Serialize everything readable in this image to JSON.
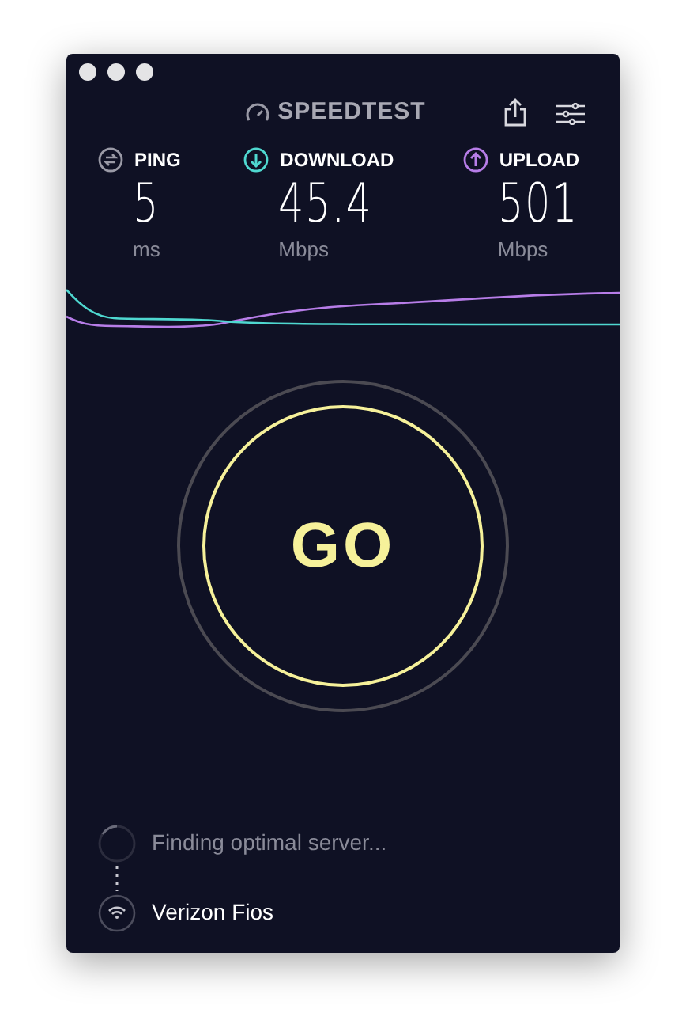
{
  "header": {
    "logo": "SPEEDTEST"
  },
  "metrics": [
    {
      "kind": "ping",
      "label": "PING",
      "value": "5",
      "unit": "ms",
      "color": "#9a9aa6"
    },
    {
      "kind": "download",
      "label": "DOWNLOAD",
      "value": "45.4",
      "unit": "Mbps",
      "color": "#4fd8d0"
    },
    {
      "kind": "upload",
      "label": "UPLOAD",
      "value": "501",
      "unit": "Mbps",
      "color": "#b77de8"
    }
  ],
  "go_button": {
    "label": "GO"
  },
  "status": {
    "server": "Finding optimal server...",
    "provider": "Verizon Fios"
  }
}
